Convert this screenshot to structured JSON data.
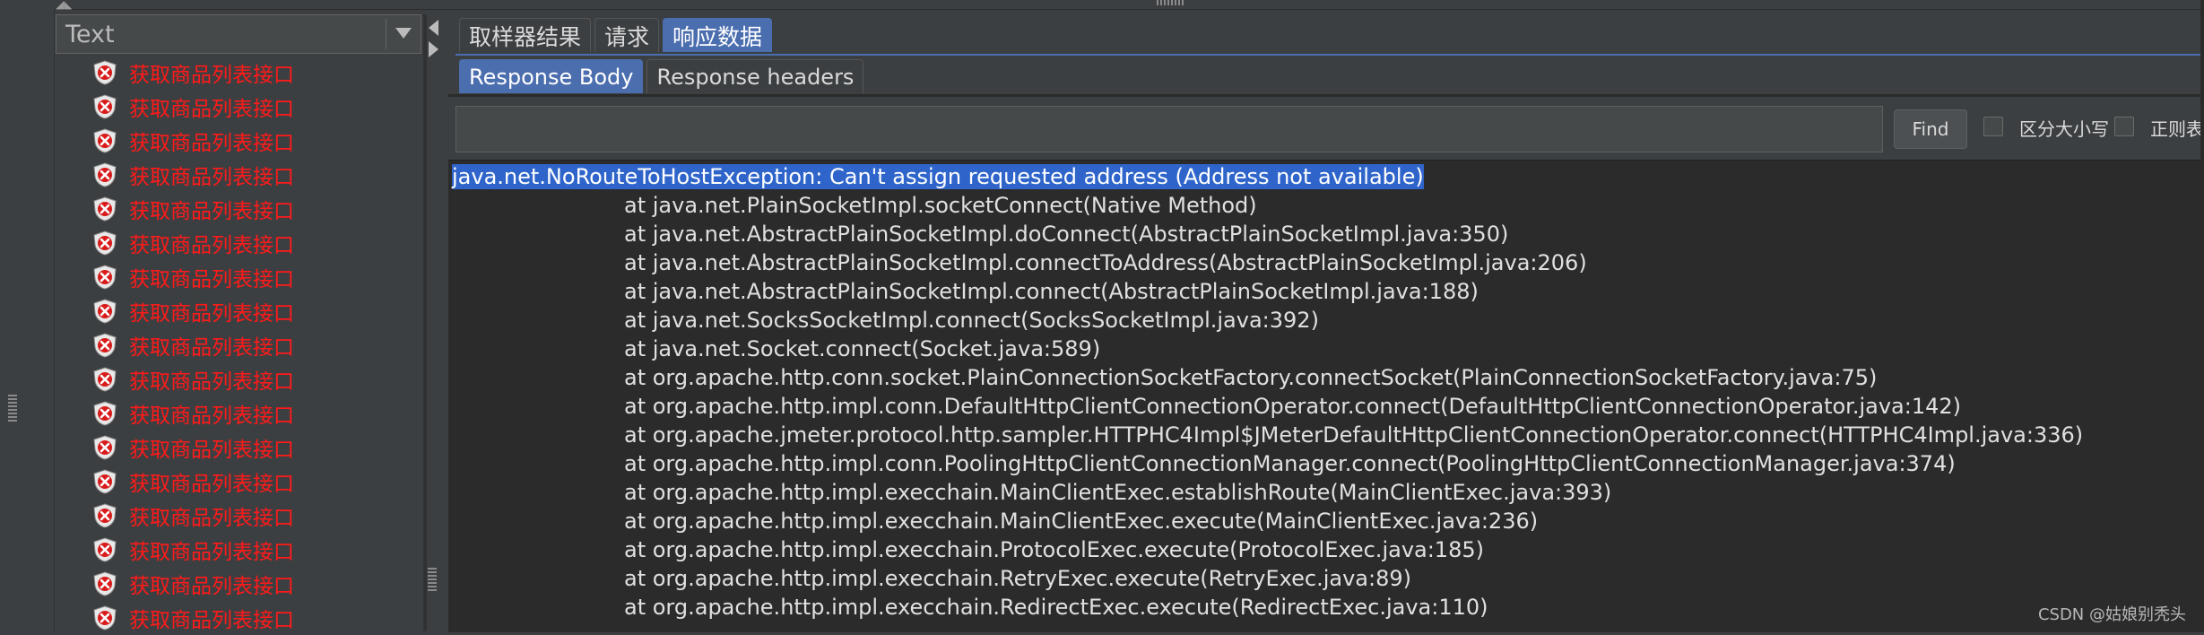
{
  "left_panel": {
    "renderer_select": {
      "value": "Text"
    },
    "results": [
      {
        "label": "获取商品列表接口",
        "status": "error"
      },
      {
        "label": "获取商品列表接口",
        "status": "error"
      },
      {
        "label": "获取商品列表接口",
        "status": "error"
      },
      {
        "label": "获取商品列表接口",
        "status": "error"
      },
      {
        "label": "获取商品列表接口",
        "status": "error"
      },
      {
        "label": "获取商品列表接口",
        "status": "error"
      },
      {
        "label": "获取商品列表接口",
        "status": "error"
      },
      {
        "label": "获取商品列表接口",
        "status": "error"
      },
      {
        "label": "获取商品列表接口",
        "status": "error"
      },
      {
        "label": "获取商品列表接口",
        "status": "error"
      },
      {
        "label": "获取商品列表接口",
        "status": "error"
      },
      {
        "label": "获取商品列表接口",
        "status": "error"
      },
      {
        "label": "获取商品列表接口",
        "status": "error"
      },
      {
        "label": "获取商品列表接口",
        "status": "error"
      },
      {
        "label": "获取商品列表接口",
        "status": "error"
      },
      {
        "label": "获取商品列表接口",
        "status": "error"
      },
      {
        "label": "获取商品列表接口",
        "status": "error"
      }
    ],
    "error_color": "#ff1a1a"
  },
  "tabs": [
    {
      "label": "取样器结果",
      "active": false
    },
    {
      "label": "请求",
      "active": false
    },
    {
      "label": "响应数据",
      "active": true
    }
  ],
  "subtabs": [
    {
      "label": "Response Body",
      "active": true
    },
    {
      "label": "Response headers",
      "active": false
    }
  ],
  "search": {
    "value": "",
    "find_label": "Find",
    "case_sensitive_label": "区分大小写",
    "regex_label": "正则表"
  },
  "response_body": {
    "lines": [
      "java.net.NoRouteToHostException: Can't assign requested address (Address not available)",
      "at java.net.PlainSocketImpl.socketConnect(Native Method)",
      "at java.net.AbstractPlainSocketImpl.doConnect(AbstractPlainSocketImpl.java:350)",
      "at java.net.AbstractPlainSocketImpl.connectToAddress(AbstractPlainSocketImpl.java:206)",
      "at java.net.AbstractPlainSocketImpl.connect(AbstractPlainSocketImpl.java:188)",
      "at java.net.SocksSocketImpl.connect(SocksSocketImpl.java:392)",
      "at java.net.Socket.connect(Socket.java:589)",
      "at org.apache.http.conn.socket.PlainConnectionSocketFactory.connectSocket(PlainConnectionSocketFactory.java:75)",
      "at org.apache.http.impl.conn.DefaultHttpClientConnectionOperator.connect(DefaultHttpClientConnectionOperator.java:142)",
      "at org.apache.jmeter.protocol.http.sampler.HTTPHC4Impl$JMeterDefaultHttpClientConnectionOperator.connect(HTTPHC4Impl.java:336)",
      "at org.apache.http.impl.conn.PoolingHttpClientConnectionManager.connect(PoolingHttpClientConnectionManager.java:374)",
      "at org.apache.http.impl.execchain.MainClientExec.establishRoute(MainClientExec.java:393)",
      "at org.apache.http.impl.execchain.MainClientExec.execute(MainClientExec.java:236)",
      "at org.apache.http.impl.execchain.ProtocolExec.execute(ProtocolExec.java:185)",
      "at org.apache.http.impl.execchain.RetryExec.execute(RetryExec.java:89)",
      "at org.apache.http.impl.execchain.RedirectExec.execute(RedirectExec.java:110)"
    ]
  },
  "watermark": "CSDN @姑娘别秃头",
  "colors": {
    "accent": "#4b6eaf",
    "selection": "#2f65ca",
    "background": "#3c3f41",
    "editor_background": "#2b2b2b"
  }
}
